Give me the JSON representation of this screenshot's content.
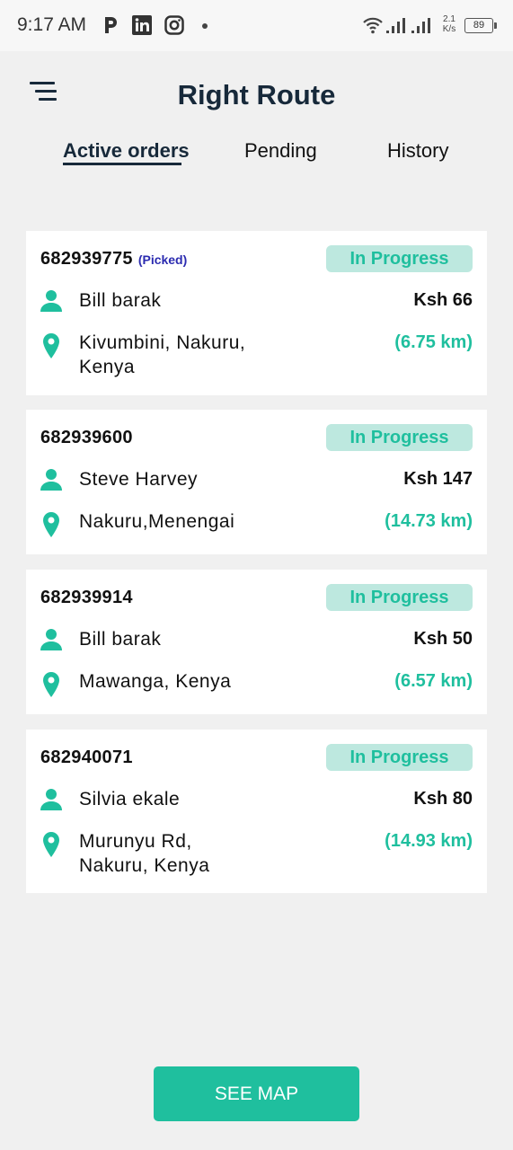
{
  "status_bar": {
    "time": "9:17 AM",
    "speed_value": "2.1",
    "speed_unit": "K/s",
    "battery": "89",
    "icons": [
      "parking-icon",
      "linkedin-icon",
      "instagram-icon",
      "wifi-icon",
      "signal-icon"
    ]
  },
  "header": {
    "title": "Right Route",
    "menu_icon": "hamburger-menu-icon"
  },
  "tabs": [
    {
      "label": "Active orders",
      "active": true
    },
    {
      "label": "Pending",
      "active": false
    },
    {
      "label": "History",
      "active": false
    }
  ],
  "orders": [
    {
      "id": "682939775",
      "tag": "(Picked)",
      "status": "In Progress",
      "customer": "Bill barak",
      "price": "Ksh 66",
      "address": "Kivumbini, Nakuru, Kenya",
      "address_lines": [
        "Kivumbini, Nakuru,",
        "Kenya"
      ],
      "distance": "(6.75 km)"
    },
    {
      "id": "682939600",
      "tag": "",
      "status": "In Progress",
      "customer": "Steve Harvey",
      "price": "Ksh 147",
      "address": "Nakuru,Menengai",
      "address_lines": [
        "Nakuru,Menengai"
      ],
      "distance": "(14.73 km)"
    },
    {
      "id": "682939914",
      "tag": "",
      "status": "In Progress",
      "customer": "Bill barak",
      "price": "Ksh 50",
      "address": "Mawanga, Kenya",
      "address_lines": [
        "Mawanga, Kenya"
      ],
      "distance": "(6.57 km)"
    },
    {
      "id": "682940071",
      "tag": "",
      "status": "In Progress",
      "customer": "Silvia ekale",
      "price": "Ksh 80",
      "address": "Murunyu Rd, Nakuru, Kenya",
      "address_lines": [
        "Murunyu Rd,",
        "Nakuru, Kenya"
      ],
      "distance": "(14.93 km)"
    }
  ],
  "colors": {
    "accent": "#1fbf9e",
    "badge_bg": "#bde8df",
    "title": "#17293a",
    "picked": "#2b2bb0"
  },
  "see_map_label": "SEE MAP"
}
